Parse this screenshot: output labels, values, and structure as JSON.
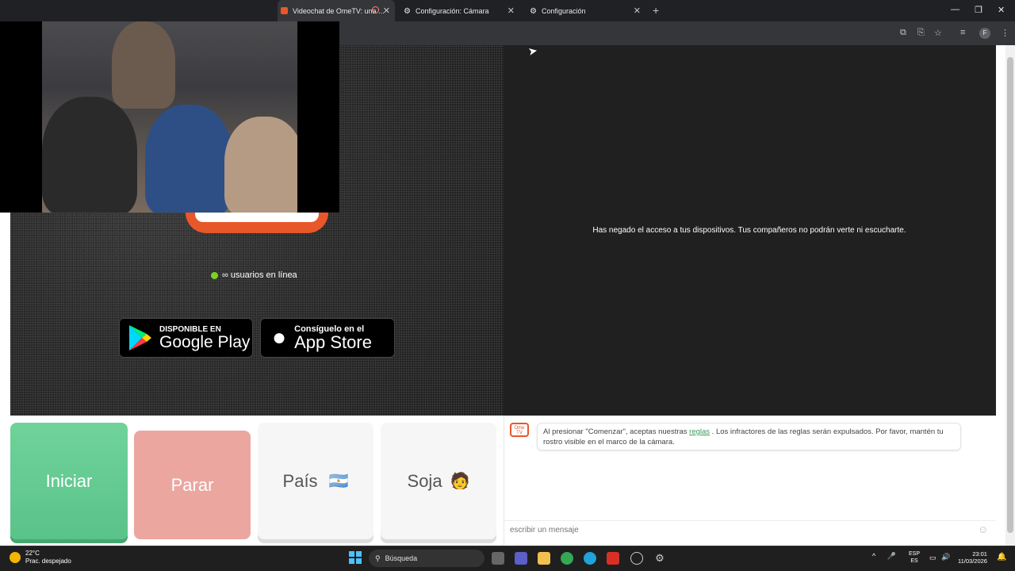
{
  "browser": {
    "tabs": [
      {
        "label": "Videochat de OmeTV: una ...",
        "active": true
      },
      {
        "label": "Configuración: Cámara",
        "active": false
      },
      {
        "label": "Configuración",
        "active": false
      }
    ],
    "profile_initial": "F"
  },
  "page": {
    "denied_message": "Has negado el acceso a tus dispositivos. Tus compañeros no podrán verte ni escucharte.",
    "online_text": "∞ usuarios en línea",
    "google_play": {
      "small": "DISPONIBLE EN",
      "big": "Google Play"
    },
    "app_store": {
      "small": "Consíguelo en el",
      "big": "App Store"
    },
    "buttons": {
      "start": "Iniciar",
      "stop": "Parar",
      "country": "País",
      "country_flag": "🇦🇷",
      "gender": "Soja",
      "gender_emoji": "🧑"
    }
  },
  "chat": {
    "logo_text": "Ome TV",
    "message_pre": "Al presionar \"Comenzar\", aceptas nuestras ",
    "message_link": "reglas",
    "message_post": " . Los infractores de las reglas serán expulsados. Por favor, mantén tu rostro visible en el marco de la cámara.",
    "input_placeholder": "escribir un mensaje"
  },
  "taskbar": {
    "temperature": "22°C",
    "weather": "Prac. despejado",
    "search_label": "Búsqueda",
    "lang_top": "ESP",
    "lang_bottom": "ES",
    "time": "23:01",
    "date": "11/03/2026"
  },
  "colors": {
    "accent_orange": "#e8572a",
    "start_green": "#5ac389",
    "stop_red": "#eba6a0",
    "online_dot": "#7ed321"
  }
}
